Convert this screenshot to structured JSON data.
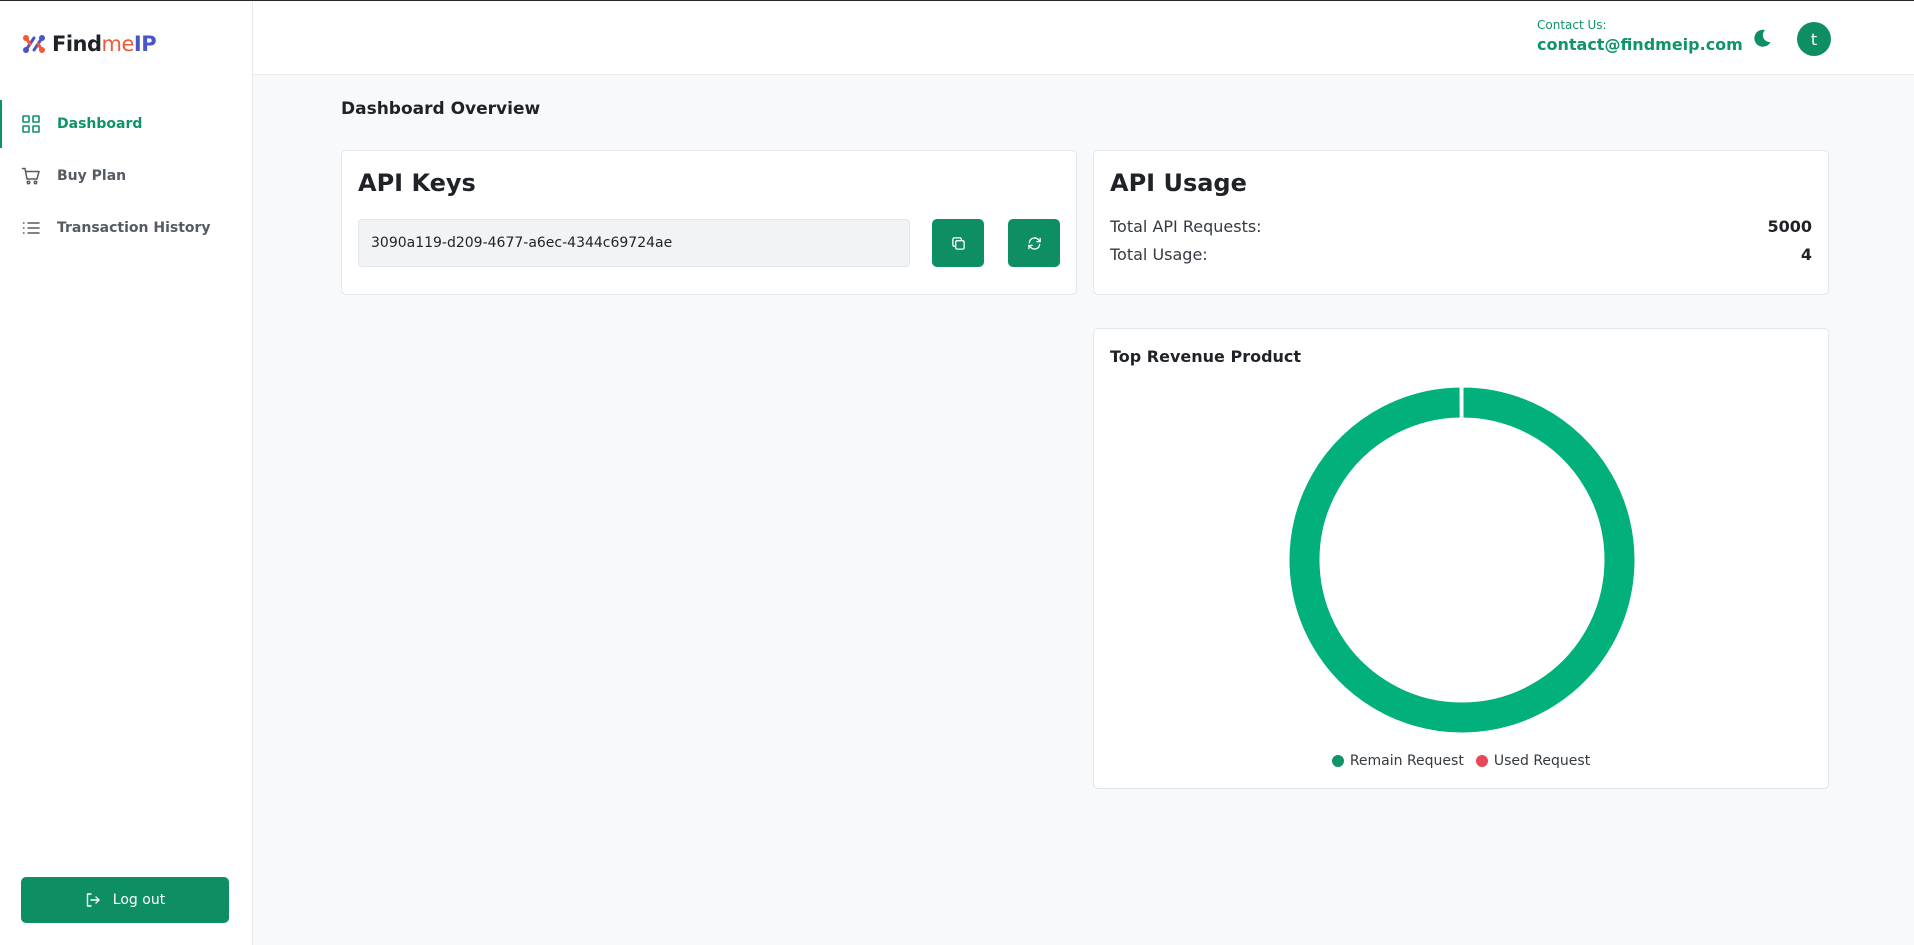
{
  "brand": {
    "part1": "Find",
    "part2": "me",
    "part3": "IP"
  },
  "sidebar": {
    "items": [
      {
        "label": "Dashboard",
        "icon": "grid-icon",
        "active": true
      },
      {
        "label": "Buy Plan",
        "icon": "cart-icon"
      },
      {
        "label": "Transaction History",
        "icon": "list-icon"
      }
    ],
    "logout_label": "Log out"
  },
  "header": {
    "contact_label": "Contact Us:",
    "contact_email": "contact@findmeip.com",
    "avatar_initial": "t"
  },
  "main": {
    "title": "Dashboard Overview",
    "api_keys": {
      "title": "API Keys",
      "key_value": "3090a119-d209-4677-a6ec-4344c69724ae"
    },
    "api_usage": {
      "title": "API Usage",
      "rows": [
        {
          "label": "Total API Requests:",
          "value": "5000"
        },
        {
          "label": "Total Usage:",
          "value": "4"
        }
      ]
    }
  },
  "chart_data": {
    "type": "pie",
    "title": "Top Revenue Product",
    "categories": [
      "Remain Request",
      "Used Request"
    ],
    "values": [
      4996,
      4
    ],
    "colors": [
      "#01b07a",
      "#e84855"
    ],
    "legend_colors": [
      "#0e9466",
      "#e84855"
    ],
    "legend": "bottom"
  },
  "colors": {
    "accent": "#0e8f63",
    "accent_text": "#0e9466"
  }
}
